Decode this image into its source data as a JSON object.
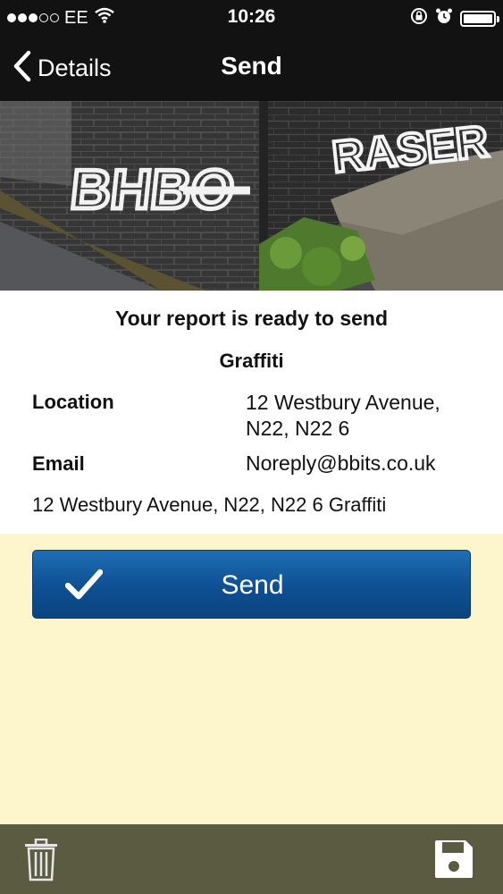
{
  "status_bar": {
    "carrier": "EE",
    "time": "10:26",
    "signal_bars_filled": 3,
    "signal_bars_total": 5,
    "battery_level": 1.0
  },
  "nav": {
    "back_label": "Details",
    "title": "Send"
  },
  "photo": {
    "graffiti_left": "BHBO",
    "graffiti_right": "RASER"
  },
  "report": {
    "heading": "Your report is ready to send",
    "category": "Graffiti",
    "location_label": "Location",
    "location_value": "12 Westbury Avenue, N22, N22 6",
    "email_label": "Email",
    "email_value": "Noreply@bbits.co.uk",
    "summary": "12 Westbury Avenue, N22, N22 6 Graffiti"
  },
  "send_button": {
    "label": "Send",
    "icon": "checkmark-icon",
    "color": "#0e4f92"
  },
  "toolbar": {
    "left_icon": "trash-icon",
    "right_icon": "save-icon",
    "background": "#5a5b40"
  },
  "colors": {
    "bar": "#121212",
    "page": "#fdf6cd"
  }
}
